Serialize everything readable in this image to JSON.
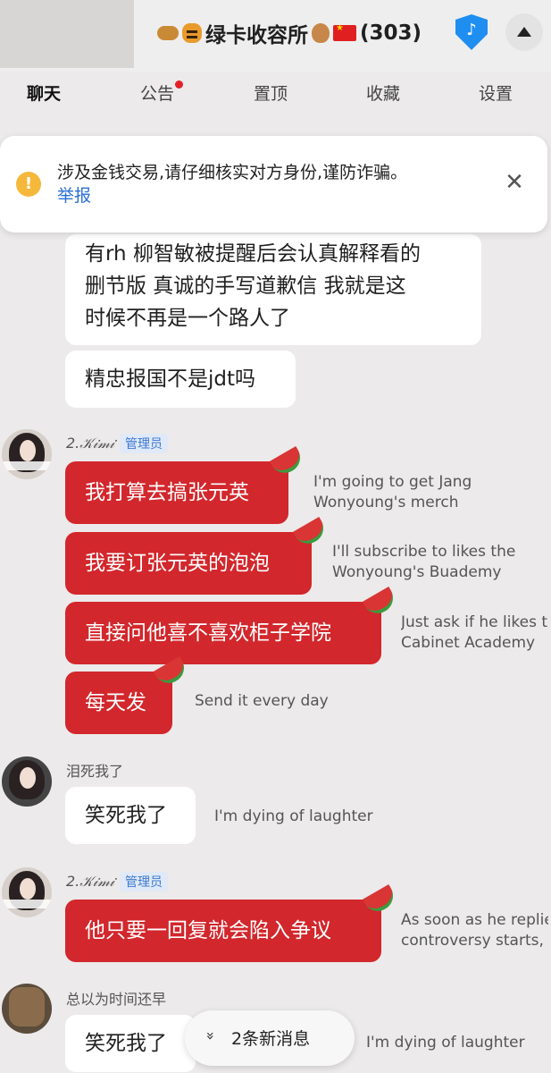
{
  "header": {
    "title_prefix": "",
    "group_name": "绿卡收容所",
    "member_count": "(303)",
    "icons": [
      "leopard-emoji",
      "tiger-emoji",
      "onion-emoji",
      "china-flag-emoji",
      "tiktok-shield-icon",
      "scroll-up-icon"
    ]
  },
  "tabs": [
    {
      "label": "聊天",
      "active": true
    },
    {
      "label": "公告",
      "has_dot": true
    },
    {
      "label": "置顶"
    },
    {
      "label": "收藏"
    },
    {
      "label": "设置"
    }
  ],
  "notice": {
    "text": "涉及金钱交易,请仔细核实对方身份,谨防诈骗。",
    "report": "举报"
  },
  "messages": {
    "m1": {
      "text_l1": "有rh 柳智敏被提醒后会认真解释看的",
      "text_l2": "删节版 真诚的手写道歉信 我就是这",
      "text_l3": "时候不再是一个路人了"
    },
    "m2": {
      "text": "精忠报国不是jdt吗"
    },
    "sender1": {
      "name": "2.𝒦𝒾𝓂𝒾",
      "badge": "管理员"
    },
    "m3": {
      "text": "我打算去搞张元英",
      "trans_l1": "I'm going to get Jang",
      "trans_l2": "Wonyoung's merch"
    },
    "m4": {
      "text": "我要订张元英的泡泡",
      "trans_l1": "I'll subscribe to likes the",
      "trans_l2": "Wonyoung's Buademy"
    },
    "m5": {
      "text": "直接问他喜不喜欢柜子学院",
      "trans_l1": "Just ask if he likes te",
      "trans_l2": "Cabinet Academy"
    },
    "m6": {
      "text": "每天发",
      "trans_l1": "Send it every day"
    },
    "sender2": {
      "name": "泪死我了"
    },
    "m7": {
      "text": "笑死我了",
      "trans_l1": "I'm dying of laughter"
    },
    "sender3": {
      "name": "2.𝒦𝒾𝓂𝒾",
      "badge": "管理员"
    },
    "m8": {
      "text": "他只要一回复就会陷入争议",
      "trans_l1": "As soon as he replies,",
      "trans_l2": "controversy starts,"
    },
    "sender4": {
      "name": "总以为时间还早"
    },
    "m9": {
      "text": "笑死我了",
      "trans_l1": "I'm dying of laughter"
    }
  },
  "new_messages": {
    "label": "2条新消息"
  },
  "colors": {
    "red_bubble": "#d2272c",
    "white_bubble": "#ffffff",
    "background": "#eceaea",
    "link_blue": "#2b6fd6",
    "warning": "#f6b83b"
  }
}
